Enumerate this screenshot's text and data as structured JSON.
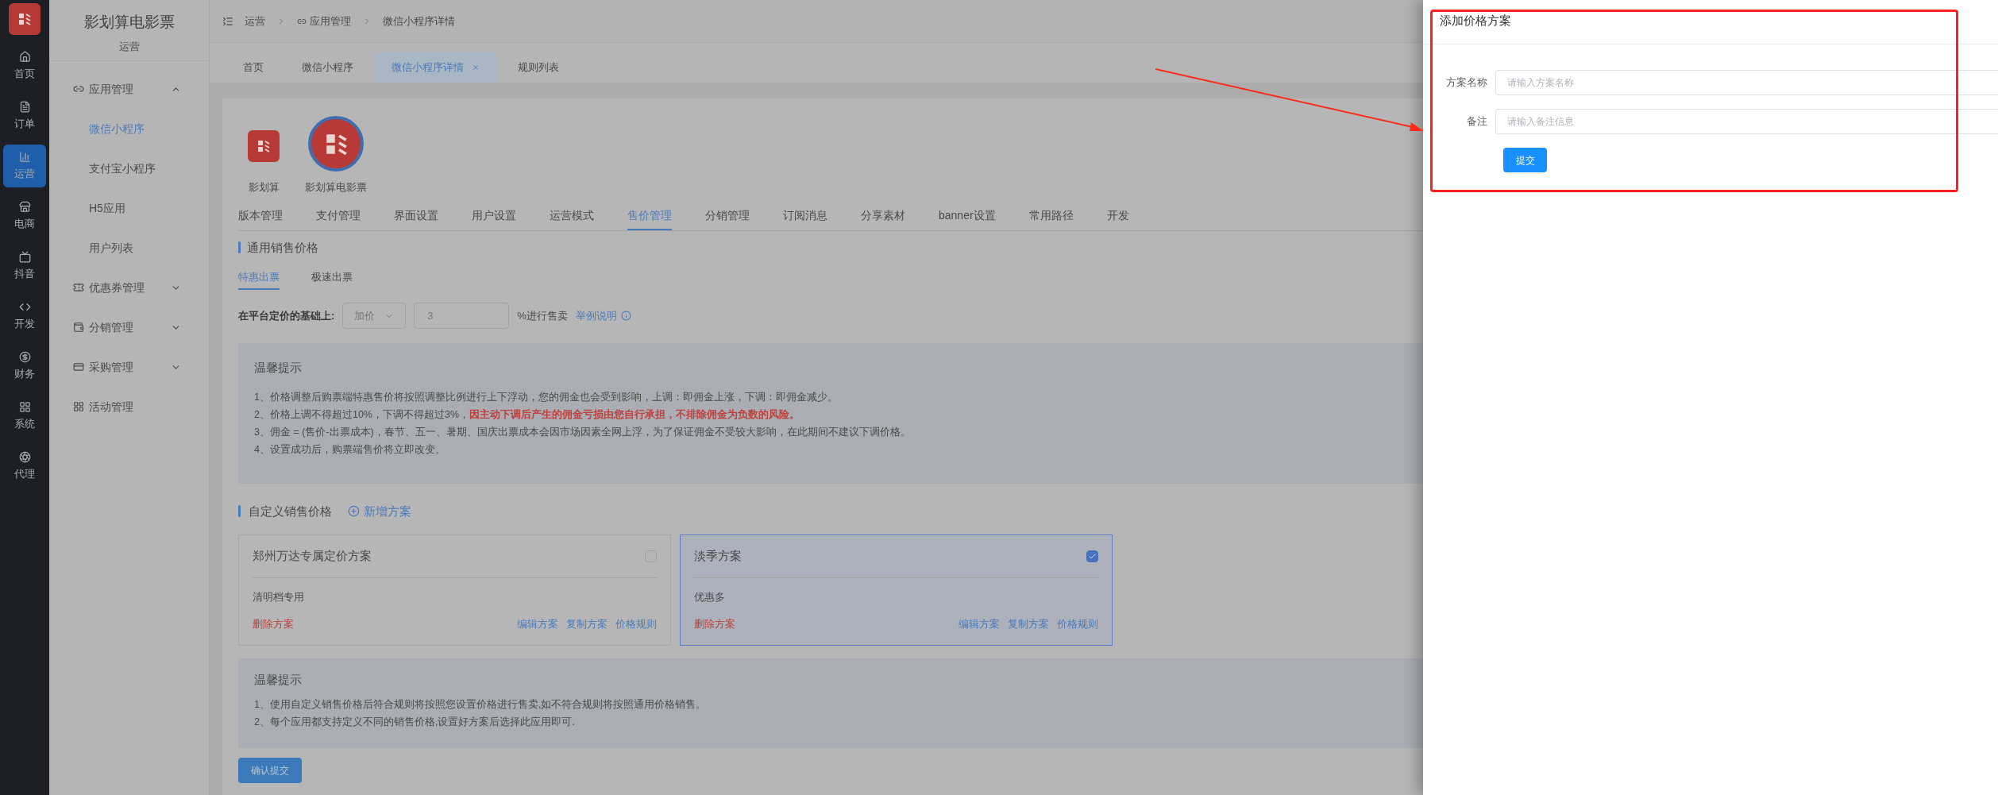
{
  "rail": {
    "items": [
      {
        "label": "首页",
        "selected": false
      },
      {
        "label": "订单",
        "selected": false
      },
      {
        "label": "运营",
        "selected": true
      },
      {
        "label": "电商",
        "selected": false
      },
      {
        "label": "抖音",
        "selected": false
      },
      {
        "label": "开发",
        "selected": false
      },
      {
        "label": "财务",
        "selected": false
      },
      {
        "label": "系统",
        "selected": false
      },
      {
        "label": "代理",
        "selected": false
      }
    ]
  },
  "sidebar": {
    "title": "影划算电影票",
    "subtitle": "运营",
    "menu": [
      {
        "label": "应用管理",
        "kind": "group",
        "expanded": true,
        "children": [
          {
            "label": "微信小程序",
            "selected": true
          },
          {
            "label": "支付宝小程序",
            "selected": false
          },
          {
            "label": "H5应用",
            "selected": false
          },
          {
            "label": "用户列表",
            "selected": false
          }
        ]
      },
      {
        "label": "优惠券管理",
        "kind": "group",
        "expanded": false
      },
      {
        "label": "分销管理",
        "kind": "group",
        "expanded": false
      },
      {
        "label": "采购管理",
        "kind": "group",
        "expanded": false
      },
      {
        "label": "活动管理",
        "kind": "item"
      }
    ]
  },
  "breadcrumb": [
    "运营",
    "应用管理",
    "微信小程序详情"
  ],
  "page_tabs": [
    {
      "label": "首页",
      "selected": false
    },
    {
      "label": "微信小程序",
      "selected": false
    },
    {
      "label": "微信小程序详情",
      "selected": true
    },
    {
      "label": "规则列表",
      "selected": false
    }
  ],
  "apps": [
    {
      "name": "影划算",
      "selected": false
    },
    {
      "name": "影划算电影票",
      "selected": true
    }
  ],
  "detail_tabs": [
    {
      "label": "版本管理",
      "selected": false
    },
    {
      "label": "支付管理",
      "selected": false
    },
    {
      "label": "界面设置",
      "selected": false
    },
    {
      "label": "用户设置",
      "selected": false
    },
    {
      "label": "运营模式",
      "selected": false
    },
    {
      "label": "售价管理",
      "selected": true
    },
    {
      "label": "分销管理",
      "selected": false
    },
    {
      "label": "订阅消息",
      "selected": false
    },
    {
      "label": "分享素材",
      "selected": false
    },
    {
      "label": "banner设置",
      "selected": false
    },
    {
      "label": "常用路径",
      "selected": false
    },
    {
      "label": "开发",
      "selected": false
    }
  ],
  "general_price": {
    "title": "通用销售价格",
    "modes": [
      {
        "label": "特惠出票",
        "selected": true
      },
      {
        "label": "极速出票",
        "selected": false
      }
    ],
    "basis_label": "在平台定价的基础上:",
    "adjust_select": {
      "value": "加价"
    },
    "percent_input": {
      "value": "3"
    },
    "suffix": "%进行售卖",
    "help_link": "举例说明"
  },
  "tips": {
    "title": "温馨提示",
    "lines": [
      {
        "text": "1、价格调整后购票端特惠售价将按照调整比例进行上下浮动，您的佣金也会受到影响，上调：即佣金上涨，下调：即佣金减少。"
      },
      {
        "text": "2、价格上调不得超过10%，下调不得超过3%，",
        "warning": "因主动下调后产生的佣金亏损由您自行承担，不排除佣金为负数的风险。"
      },
      {
        "text": "3、佣金 = (售价-出票成本)，春节、五一、暑期、国庆出票成本会因市场因素全网上浮，为了保证佣金不受较大影响，在此期间不建议下调价格。"
      },
      {
        "text": "4、设置成功后，购票端售价将立即改变。"
      }
    ]
  },
  "custom_price": {
    "title": "自定义销售价格",
    "add_link": "新增方案",
    "plans": [
      {
        "name": "郑州万达专属定价方案",
        "checked": false,
        "note": "清明档专用",
        "delete": "删除方案",
        "actions": [
          "编辑方案",
          "复制方案",
          "价格规则"
        ]
      },
      {
        "name": "淡季方案",
        "checked": true,
        "note": "优惠多",
        "delete": "删除方案",
        "actions": [
          "编辑方案",
          "复制方案",
          "价格规则"
        ]
      }
    ]
  },
  "tips2": {
    "title": "温馨提示",
    "lines": [
      "1、使用自定义销售价格后符合规则将按照您设置价格进行售卖,如不符合规则将按照通用价格销售。",
      "2、每个应用都支持定义不同的销售价格,设置好方案后选择此应用即可."
    ]
  },
  "confirm_button": "确认提交",
  "drawer": {
    "title": "添加价格方案",
    "fields": [
      {
        "label": "方案名称",
        "placeholder": "请输入方案名称"
      },
      {
        "label": "备注",
        "placeholder": "请输入备注信息"
      }
    ],
    "submit": "提交"
  }
}
